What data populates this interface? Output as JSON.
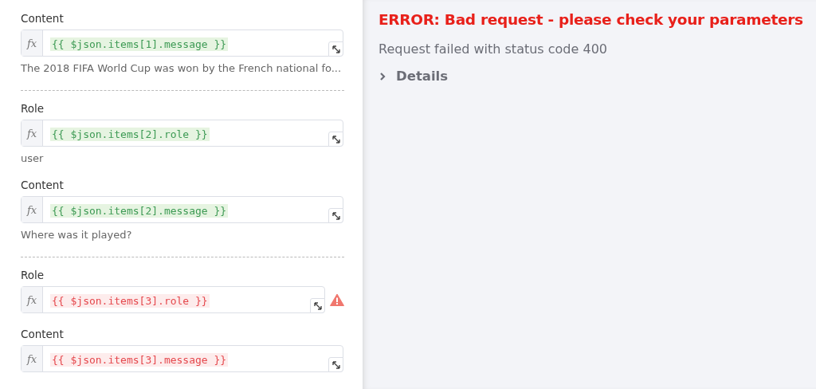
{
  "groups": [
    {
      "fields": [
        {
          "label": "Content",
          "prefix": "fx",
          "expression": "{{ $json.items[1].message }}",
          "valid": true,
          "warning": false,
          "result": "The 2018 FIFA World Cup was won by the French national fo..."
        }
      ]
    },
    {
      "fields": [
        {
          "label": "Role",
          "prefix": "fx",
          "expression": "{{ $json.items[2].role }}",
          "valid": true,
          "warning": false,
          "result": "user"
        },
        {
          "label": "Content",
          "prefix": "fx",
          "expression": "{{ $json.items[2].message }}",
          "valid": true,
          "warning": false,
          "result": "Where was it played?"
        }
      ]
    },
    {
      "fields": [
        {
          "label": "Role",
          "prefix": "fx",
          "expression": "{{ $json.items[3].role }}",
          "valid": false,
          "warning": true
        },
        {
          "label": "Content",
          "prefix": "fx",
          "expression": "{{ $json.items[3].message }}",
          "valid": false,
          "warning": false
        }
      ]
    }
  ],
  "error": {
    "title": "ERROR: Bad request - please check your parameters",
    "message": "Request failed with status code 400",
    "details": {
      "label": "Details",
      "expanded": false
    }
  }
}
